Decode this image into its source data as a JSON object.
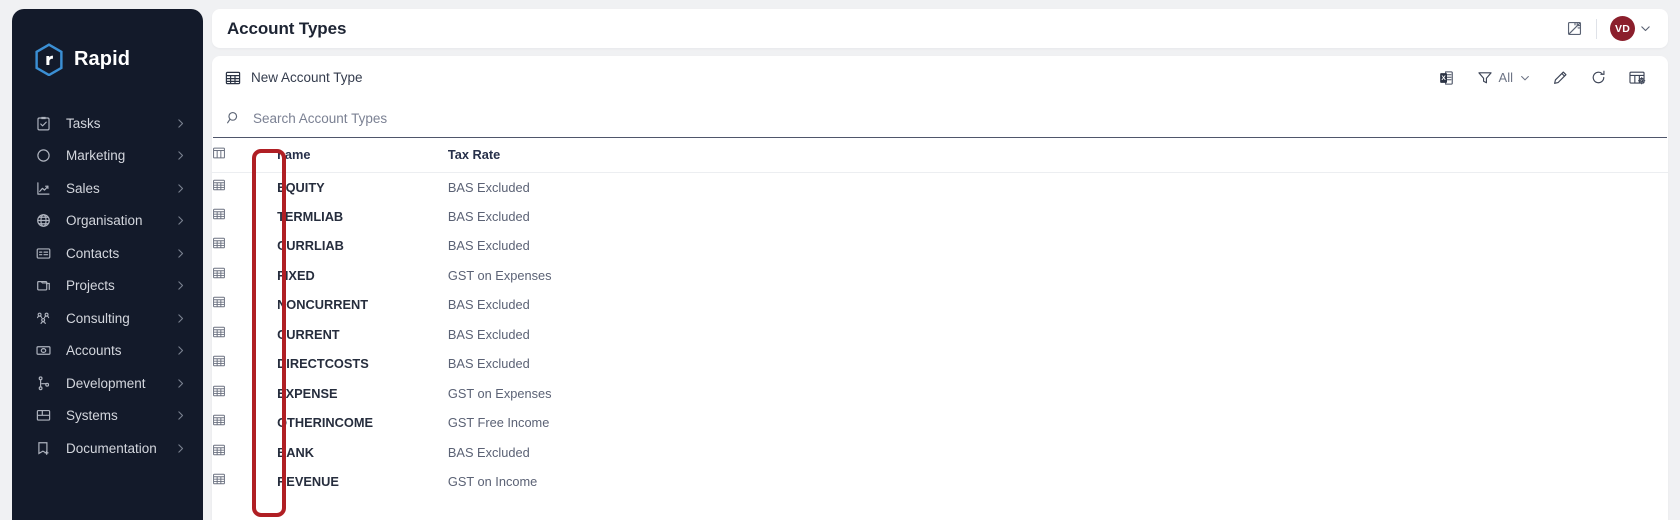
{
  "brand": {
    "name": "Rapid",
    "logo_icon": "rapid-hexagon-logo",
    "accent": "#3b8fd4"
  },
  "sidebar": {
    "items": [
      {
        "label": "Tasks",
        "icon": "clipboard-check-icon"
      },
      {
        "label": "Marketing",
        "icon": "circle-icon"
      },
      {
        "label": "Sales",
        "icon": "trend-up-chart-icon"
      },
      {
        "label": "Organisation",
        "icon": "globe-icon"
      },
      {
        "label": "Contacts",
        "icon": "contact-card-icon"
      },
      {
        "label": "Projects",
        "icon": "folders-icon"
      },
      {
        "label": "Consulting",
        "icon": "people-group-icon"
      },
      {
        "label": "Accounts",
        "icon": "banknote-icon"
      },
      {
        "label": "Development",
        "icon": "branch-node-icon"
      },
      {
        "label": "Systems",
        "icon": "desktop-layout-icon"
      },
      {
        "label": "Documentation",
        "icon": "document-add-icon"
      }
    ],
    "chevron_icon": "chevron-right-icon",
    "background": "#131a2a"
  },
  "header": {
    "title": "Account Types",
    "measure_icon": "ruler-diagonal-icon",
    "avatar_initials": "VD",
    "avatar_color": "#8b1f2c",
    "avatar_chevron_icon": "chevron-down-icon"
  },
  "toolbar": {
    "new_button_label": "New Account Type",
    "new_button_icon": "table-grid-icon",
    "excel_export_icon": "excel-export-icon",
    "filter_icon": "funnel-filter-icon",
    "filter_value": "All",
    "filter_chevron_icon": "chevron-down-icon",
    "edit_icon": "pencil-edit-icon",
    "refresh_icon": "refresh-circular-icon",
    "columns_icon": "table-settings-icon"
  },
  "search": {
    "placeholder": "Search Account Types",
    "value": "",
    "icon": "magnifier-search-icon"
  },
  "table": {
    "row_icon": "table-grid-icon",
    "columns": [
      "",
      "name",
      "Tax Rate"
    ],
    "rows": [
      {
        "name": "EQUITY",
        "tax_rate": "BAS Excluded"
      },
      {
        "name": "TERMLIAB",
        "tax_rate": "BAS Excluded"
      },
      {
        "name": "CURRLIAB",
        "tax_rate": "BAS Excluded"
      },
      {
        "name": "FIXED",
        "tax_rate": "GST on Expenses"
      },
      {
        "name": "NONCURRENT",
        "tax_rate": "BAS Excluded"
      },
      {
        "name": "CURRENT",
        "tax_rate": "BAS Excluded"
      },
      {
        "name": "DIRECTCOSTS",
        "tax_rate": "BAS Excluded"
      },
      {
        "name": "EXPENSE",
        "tax_rate": "GST on Expenses"
      },
      {
        "name": "OTHERINCOME",
        "tax_rate": "GST Free Income"
      },
      {
        "name": "BANK",
        "tax_rate": "BAS Excluded"
      },
      {
        "name": "REVENUE",
        "tax_rate": "GST on Income"
      }
    ]
  },
  "annotation": {
    "highlight_color": "#b01f24",
    "target": "row-icon-column"
  }
}
